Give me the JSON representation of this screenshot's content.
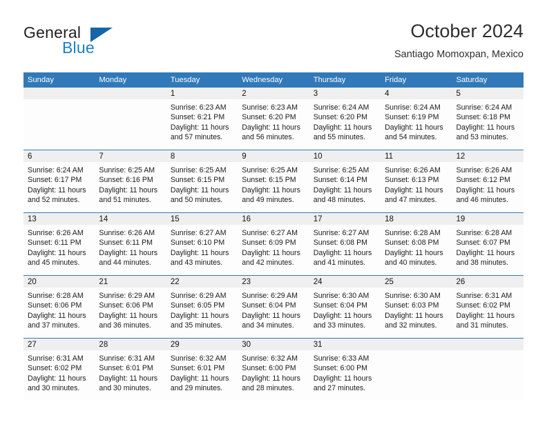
{
  "brand": {
    "name_part1": "General",
    "name_part2": "Blue",
    "logo_icon": "triangle-logo-icon"
  },
  "header": {
    "title": "October 2024",
    "subtitle": "Santiago Momoxpan, Mexico"
  },
  "colors": {
    "header_blue": "#3179b8",
    "brand_blue": "#1d7fc3",
    "daynum_bg": "#efefef",
    "cell_bg": "#fdfdfd"
  },
  "calendar": {
    "weekday_headers": [
      "Sunday",
      "Monday",
      "Tuesday",
      "Wednesday",
      "Thursday",
      "Friday",
      "Saturday"
    ],
    "weeks": [
      [
        {
          "day": "",
          "sunrise": "",
          "sunset": "",
          "daylight": "",
          "empty": true
        },
        {
          "day": "",
          "sunrise": "",
          "sunset": "",
          "daylight": "",
          "empty": true
        },
        {
          "day": "1",
          "sunrise": "Sunrise: 6:23 AM",
          "sunset": "Sunset: 6:21 PM",
          "daylight": "Daylight: 11 hours and 57 minutes.",
          "empty": false
        },
        {
          "day": "2",
          "sunrise": "Sunrise: 6:23 AM",
          "sunset": "Sunset: 6:20 PM",
          "daylight": "Daylight: 11 hours and 56 minutes.",
          "empty": false
        },
        {
          "day": "3",
          "sunrise": "Sunrise: 6:24 AM",
          "sunset": "Sunset: 6:20 PM",
          "daylight": "Daylight: 11 hours and 55 minutes.",
          "empty": false
        },
        {
          "day": "4",
          "sunrise": "Sunrise: 6:24 AM",
          "sunset": "Sunset: 6:19 PM",
          "daylight": "Daylight: 11 hours and 54 minutes.",
          "empty": false
        },
        {
          "day": "5",
          "sunrise": "Sunrise: 6:24 AM",
          "sunset": "Sunset: 6:18 PM",
          "daylight": "Daylight: 11 hours and 53 minutes.",
          "empty": false
        }
      ],
      [
        {
          "day": "6",
          "sunrise": "Sunrise: 6:24 AM",
          "sunset": "Sunset: 6:17 PM",
          "daylight": "Daylight: 11 hours and 52 minutes.",
          "empty": false
        },
        {
          "day": "7",
          "sunrise": "Sunrise: 6:25 AM",
          "sunset": "Sunset: 6:16 PM",
          "daylight": "Daylight: 11 hours and 51 minutes.",
          "empty": false
        },
        {
          "day": "8",
          "sunrise": "Sunrise: 6:25 AM",
          "sunset": "Sunset: 6:15 PM",
          "daylight": "Daylight: 11 hours and 50 minutes.",
          "empty": false
        },
        {
          "day": "9",
          "sunrise": "Sunrise: 6:25 AM",
          "sunset": "Sunset: 6:15 PM",
          "daylight": "Daylight: 11 hours and 49 minutes.",
          "empty": false
        },
        {
          "day": "10",
          "sunrise": "Sunrise: 6:25 AM",
          "sunset": "Sunset: 6:14 PM",
          "daylight": "Daylight: 11 hours and 48 minutes.",
          "empty": false
        },
        {
          "day": "11",
          "sunrise": "Sunrise: 6:26 AM",
          "sunset": "Sunset: 6:13 PM",
          "daylight": "Daylight: 11 hours and 47 minutes.",
          "empty": false
        },
        {
          "day": "12",
          "sunrise": "Sunrise: 6:26 AM",
          "sunset": "Sunset: 6:12 PM",
          "daylight": "Daylight: 11 hours and 46 minutes.",
          "empty": false
        }
      ],
      [
        {
          "day": "13",
          "sunrise": "Sunrise: 6:26 AM",
          "sunset": "Sunset: 6:11 PM",
          "daylight": "Daylight: 11 hours and 45 minutes.",
          "empty": false
        },
        {
          "day": "14",
          "sunrise": "Sunrise: 6:26 AM",
          "sunset": "Sunset: 6:11 PM",
          "daylight": "Daylight: 11 hours and 44 minutes.",
          "empty": false
        },
        {
          "day": "15",
          "sunrise": "Sunrise: 6:27 AM",
          "sunset": "Sunset: 6:10 PM",
          "daylight": "Daylight: 11 hours and 43 minutes.",
          "empty": false
        },
        {
          "day": "16",
          "sunrise": "Sunrise: 6:27 AM",
          "sunset": "Sunset: 6:09 PM",
          "daylight": "Daylight: 11 hours and 42 minutes.",
          "empty": false
        },
        {
          "day": "17",
          "sunrise": "Sunrise: 6:27 AM",
          "sunset": "Sunset: 6:08 PM",
          "daylight": "Daylight: 11 hours and 41 minutes.",
          "empty": false
        },
        {
          "day": "18",
          "sunrise": "Sunrise: 6:28 AM",
          "sunset": "Sunset: 6:08 PM",
          "daylight": "Daylight: 11 hours and 40 minutes.",
          "empty": false
        },
        {
          "day": "19",
          "sunrise": "Sunrise: 6:28 AM",
          "sunset": "Sunset: 6:07 PM",
          "daylight": "Daylight: 11 hours and 38 minutes.",
          "empty": false
        }
      ],
      [
        {
          "day": "20",
          "sunrise": "Sunrise: 6:28 AM",
          "sunset": "Sunset: 6:06 PM",
          "daylight": "Daylight: 11 hours and 37 minutes.",
          "empty": false
        },
        {
          "day": "21",
          "sunrise": "Sunrise: 6:29 AM",
          "sunset": "Sunset: 6:06 PM",
          "daylight": "Daylight: 11 hours and 36 minutes.",
          "empty": false
        },
        {
          "day": "22",
          "sunrise": "Sunrise: 6:29 AM",
          "sunset": "Sunset: 6:05 PM",
          "daylight": "Daylight: 11 hours and 35 minutes.",
          "empty": false
        },
        {
          "day": "23",
          "sunrise": "Sunrise: 6:29 AM",
          "sunset": "Sunset: 6:04 PM",
          "daylight": "Daylight: 11 hours and 34 minutes.",
          "empty": false
        },
        {
          "day": "24",
          "sunrise": "Sunrise: 6:30 AM",
          "sunset": "Sunset: 6:04 PM",
          "daylight": "Daylight: 11 hours and 33 minutes.",
          "empty": false
        },
        {
          "day": "25",
          "sunrise": "Sunrise: 6:30 AM",
          "sunset": "Sunset: 6:03 PM",
          "daylight": "Daylight: 11 hours and 32 minutes.",
          "empty": false
        },
        {
          "day": "26",
          "sunrise": "Sunrise: 6:31 AM",
          "sunset": "Sunset: 6:02 PM",
          "daylight": "Daylight: 11 hours and 31 minutes.",
          "empty": false
        }
      ],
      [
        {
          "day": "27",
          "sunrise": "Sunrise: 6:31 AM",
          "sunset": "Sunset: 6:02 PM",
          "daylight": "Daylight: 11 hours and 30 minutes.",
          "empty": false
        },
        {
          "day": "28",
          "sunrise": "Sunrise: 6:31 AM",
          "sunset": "Sunset: 6:01 PM",
          "daylight": "Daylight: 11 hours and 30 minutes.",
          "empty": false
        },
        {
          "day": "29",
          "sunrise": "Sunrise: 6:32 AM",
          "sunset": "Sunset: 6:01 PM",
          "daylight": "Daylight: 11 hours and 29 minutes.",
          "empty": false
        },
        {
          "day": "30",
          "sunrise": "Sunrise: 6:32 AM",
          "sunset": "Sunset: 6:00 PM",
          "daylight": "Daylight: 11 hours and 28 minutes.",
          "empty": false
        },
        {
          "day": "31",
          "sunrise": "Sunrise: 6:33 AM",
          "sunset": "Sunset: 6:00 PM",
          "daylight": "Daylight: 11 hours and 27 minutes.",
          "empty": false
        },
        {
          "day": "",
          "sunrise": "",
          "sunset": "",
          "daylight": "",
          "empty": true
        },
        {
          "day": "",
          "sunrise": "",
          "sunset": "",
          "daylight": "",
          "empty": true
        }
      ]
    ]
  }
}
